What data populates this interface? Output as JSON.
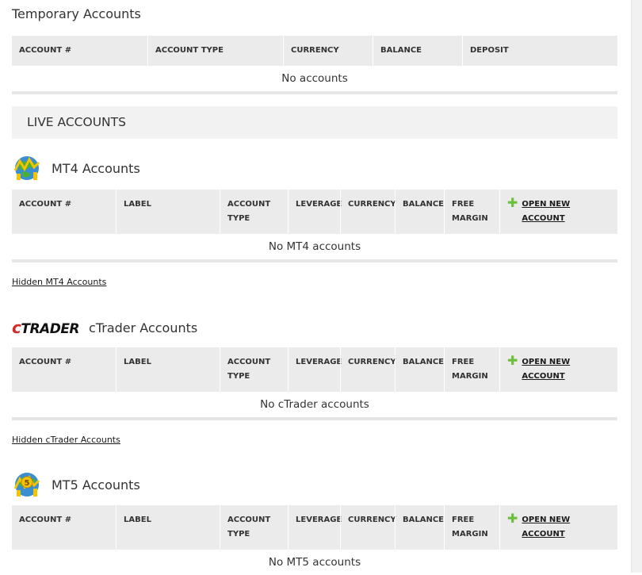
{
  "temporary": {
    "title": "Temporary Accounts",
    "columns": [
      "ACCOUNT #",
      "ACCOUNT TYPE",
      "CURRENCY",
      "BALANCE",
      "DEPOSIT"
    ],
    "empty_text": "No accounts"
  },
  "live": {
    "banner": "LIVE ACCOUNTS"
  },
  "mt4": {
    "title": "MT4 Accounts",
    "columns": [
      "ACCOUNT #",
      "LABEL",
      "ACCOUNT TYPE",
      "LEVERAGE",
      "CURRENCY",
      "BALANCE",
      "FREE MARGIN"
    ],
    "open_label": "OPEN NEW ACCOUNT",
    "empty_text": "No MT4 accounts",
    "hidden_link": "Hidden MT4 Accounts"
  },
  "ctrader": {
    "title": "cTrader Accounts",
    "logo_text_c": "c",
    "logo_text_rest": "TRADER",
    "columns": [
      "ACCOUNT #",
      "LABEL",
      "ACCOUNT TYPE",
      "LEVERAGE",
      "CURRENCY",
      "BALANCE",
      "FREE MARGIN"
    ],
    "open_label": "OPEN NEW ACCOUNT",
    "empty_text": "No cTrader accounts",
    "hidden_link": "Hidden cTrader Accounts"
  },
  "mt5": {
    "title": "MT5 Accounts",
    "logo_number": "5",
    "columns": [
      "ACCOUNT #",
      "LABEL",
      "ACCOUNT TYPE",
      "LEVERAGE",
      "CURRENCY",
      "BALANCE",
      "FREE MARGIN"
    ],
    "open_label": "OPEN NEW ACCOUNT",
    "empty_text": "No MT5 accounts"
  },
  "colors": {
    "header_bg": "#ebebeb",
    "accent_plus": "#6cbf3a",
    "ctrader_red": "#d42a2a"
  }
}
